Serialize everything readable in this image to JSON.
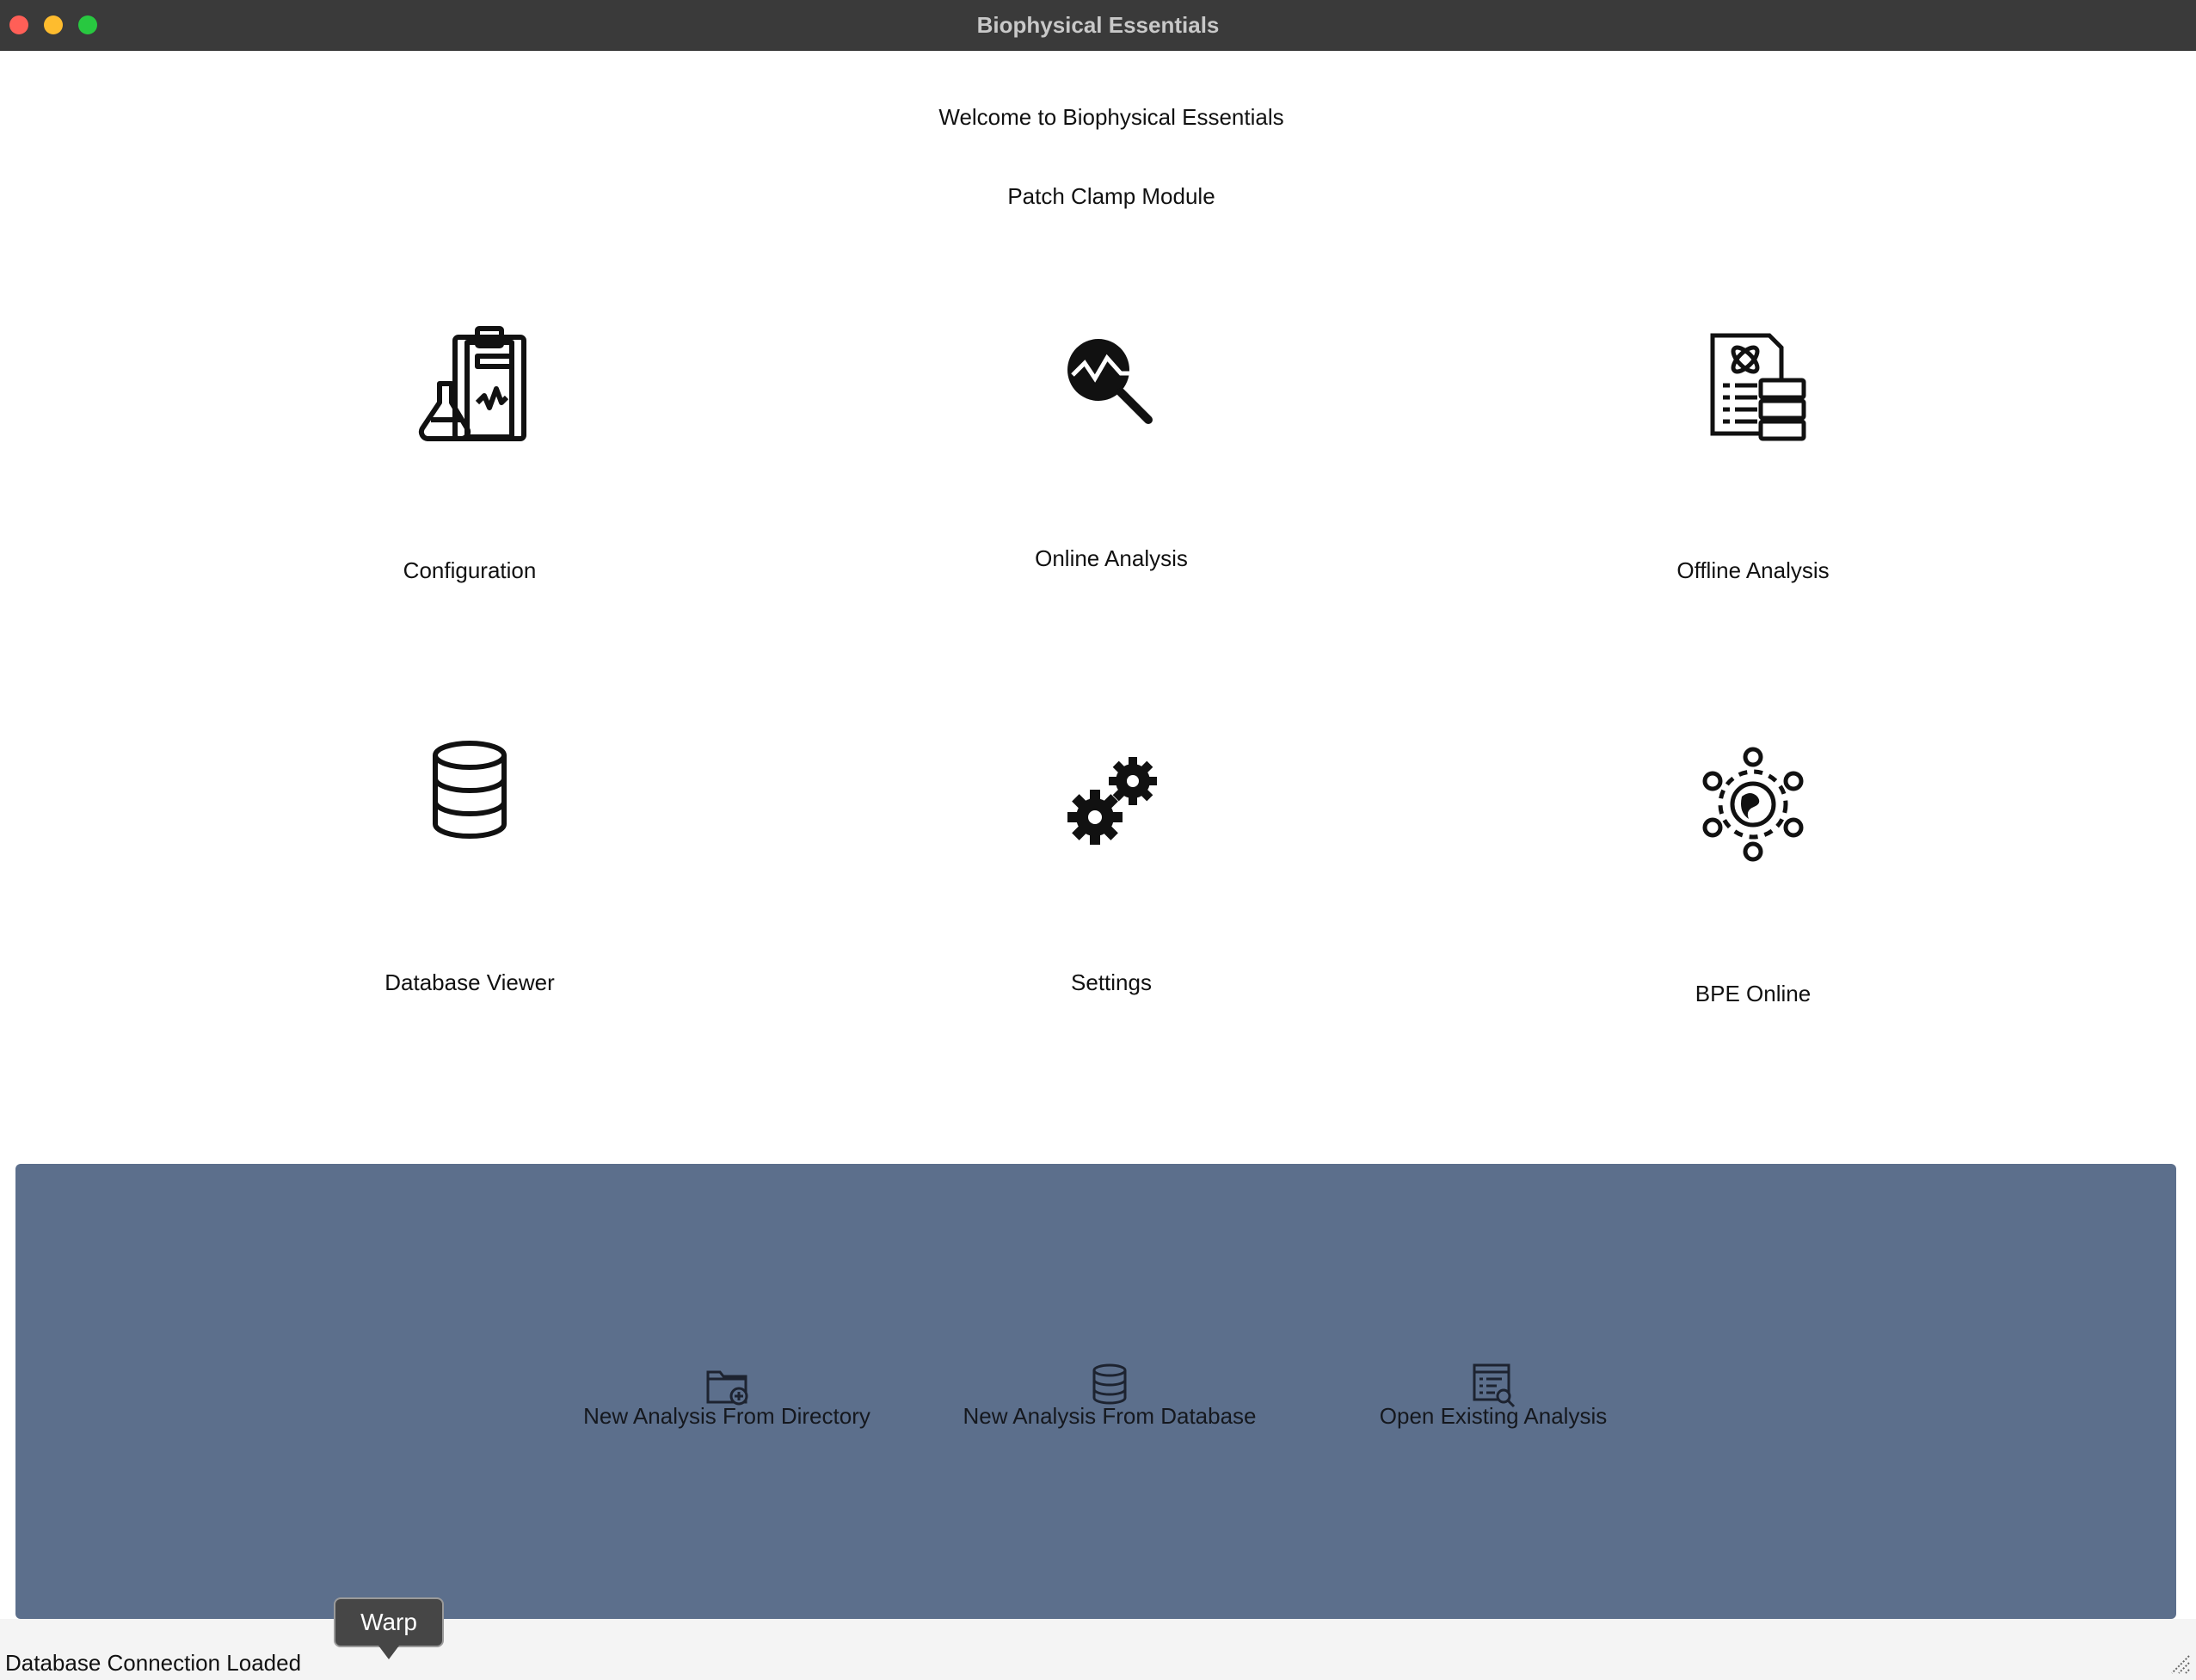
{
  "window": {
    "title": "Biophysical Essentials"
  },
  "header": {
    "welcome": "Welcome to Biophysical Essentials",
    "module": "Patch Clamp Module"
  },
  "tiles": [
    {
      "label": "Configuration",
      "icon": "clipboard-flask-icon"
    },
    {
      "label": "Online Analysis",
      "icon": "magnifier-waveform-icon"
    },
    {
      "label": "Offline Analysis",
      "icon": "document-atom-stack-icon"
    },
    {
      "label": "Database Viewer",
      "icon": "database-icon"
    },
    {
      "label": "Settings",
      "icon": "gears-icon"
    },
    {
      "label": "BPE Online",
      "icon": "globe-network-icon"
    }
  ],
  "analysis_panel": {
    "background": "#5c6f8c",
    "buttons": [
      {
        "label": "New Analysis From Directory",
        "icon": "folder-add-icon"
      },
      {
        "label": "New Analysis From Database",
        "icon": "database-icon"
      },
      {
        "label": "Open Existing Analysis",
        "icon": "report-search-icon"
      }
    ]
  },
  "status_bar": {
    "text": "Database Connection Loaded"
  },
  "tooltip": {
    "text": "Warp"
  }
}
